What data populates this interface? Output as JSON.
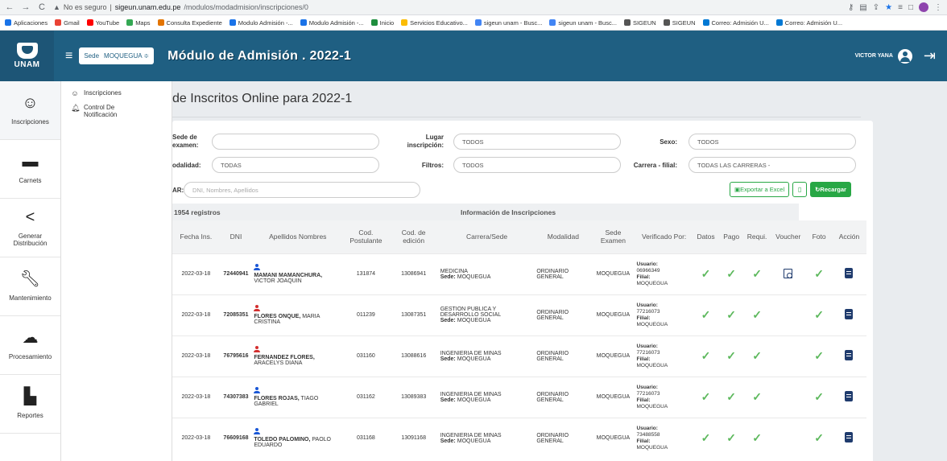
{
  "browser": {
    "warning": "No es seguro",
    "url_host": "sigeun.unam.edu.pe",
    "url_path": "/modulos/modadmision/inscripciones/0"
  },
  "bookmarks": [
    "Aplicaciones",
    "Gmail",
    "YouTube",
    "Maps",
    "Consulta Expediente",
    "Modulo Admisión -...",
    "Modulo Admisión -...",
    "Inicio",
    "Servicios Educativo...",
    "sigeun unam - Busc...",
    "sigeun unam - Busc...",
    "SIGEUN",
    "SIGEUN",
    "Correo: Admisión U...",
    "Correo: Admisión U..."
  ],
  "header": {
    "logo_text": "UNAM",
    "sede_label": "Sede",
    "sede_value": "MOQUEGUA ≑",
    "title": "Módulo de Admisión . 2022-1",
    "user": "VICTOR YANA"
  },
  "sidebar": [
    {
      "label": "Inscripciones",
      "icon": "smile-icon"
    },
    {
      "label": "Carnets",
      "icon": "card-icon"
    },
    {
      "label": "Generar Distribución",
      "icon": "share-icon"
    },
    {
      "label": "Mantenimiento",
      "icon": "wrench-icon"
    },
    {
      "label": "Procesamiento",
      "icon": "cloud-icon"
    },
    {
      "label": "Reportes",
      "icon": "file-icon"
    }
  ],
  "submenu": [
    {
      "label": "Inscripciones"
    },
    {
      "label": "Control De Notificación"
    }
  ],
  "page": {
    "title": "de Inscritos Online para 2022-1"
  },
  "filters": {
    "sede_examen_label": "Sede de examen:",
    "sede_examen_value": "",
    "lugar_label": "Lugar inscripción:",
    "lugar_value": "TODOS",
    "sexo_label": "Sexo:",
    "sexo_value": "TODOS",
    "modalidad_label": "odalidad:",
    "modalidad_value": "TODAS",
    "filtros_label": "Filtros:",
    "filtros_value": "TODOS",
    "carrera_label": "Carrera - filial:",
    "carrera_value": "TODAS LAS CARRERAS -",
    "search_label": "AR:",
    "search_placeholder": "DNI, Nombres, Apellidos"
  },
  "buttons": {
    "excel": "Exportar a Excel",
    "reload": "Recargar"
  },
  "info": {
    "registros": "1954 registros",
    "heading": "Información de Inscripciones"
  },
  "columns": [
    "Fecha Ins.",
    "DNI",
    "Apellidos Nombres",
    "Cod. Postulante",
    "Cod. de edición",
    "Carrera/Sede",
    "Modalidad",
    "Sede Examen",
    "Verificado Por:",
    "Datos",
    "Pago",
    "Requi.",
    "Voucher",
    "Foto",
    "Acción"
  ],
  "rows": [
    {
      "fecha": "2022-03-18",
      "dni": "72440941",
      "apellidos": "MAMANI MAMANCHURA,",
      "nombres": " VICTOR JOAQUIN",
      "sex": "m",
      "cod_post": "131874",
      "cod_ed": "13086941",
      "carrera": "MEDICINA",
      "sede": "MOQUEGUA",
      "modalidad": "ORDINARIO GENERAL",
      "sede_ex": "MOQUEGUA",
      "usuario": "06966349",
      "filial": "MOQUEGUA",
      "voucher": true
    },
    {
      "fecha": "2022-03-18",
      "dni": "72085351",
      "apellidos": "FLORES ONQUE,",
      "nombres": " MARIA CRISTINA",
      "sex": "f",
      "cod_post": "011239",
      "cod_ed": "13087351",
      "carrera": "GESTION PUBLICA Y DESARROLLO SOCIAL",
      "sede": "MOQUEGUA",
      "modalidad": "ORDINARIO GENERAL",
      "sede_ex": "MOQUEGUA",
      "usuario": "77216073",
      "filial": "MOQUEGUA",
      "voucher": false
    },
    {
      "fecha": "2022-03-18",
      "dni": "76795616",
      "apellidos": "FERNANDEZ FLORES,",
      "nombres": " ARACELYS DIANA",
      "sex": "f",
      "cod_post": "031160",
      "cod_ed": "13088616",
      "carrera": "INGENIERIA DE MINAS",
      "sede": "MOQUEGUA",
      "modalidad": "ORDINARIO GENERAL",
      "sede_ex": "MOQUEGUA",
      "usuario": "77216073",
      "filial": "MOQUEGUA",
      "voucher": false
    },
    {
      "fecha": "2022-03-18",
      "dni": "74307383",
      "apellidos": "FLORES ROJAS,",
      "nombres": " TIAGO GABRIEL",
      "sex": "m",
      "cod_post": "031162",
      "cod_ed": "13089383",
      "carrera": "INGENIERIA DE MINAS",
      "sede": "MOQUEGUA",
      "modalidad": "ORDINARIO GENERAL",
      "sede_ex": "MOQUEGUA",
      "usuario": "77216073",
      "filial": "MOQUEGUA",
      "voucher": false
    },
    {
      "fecha": "2022-03-18",
      "dni": "76609168",
      "apellidos": "TOLEDO PALOMINO,",
      "nombres": " PAOLO EDUARDO",
      "sex": "m",
      "cod_post": "031168",
      "cod_ed": "13091168",
      "carrera": "INGENIERIA DE MINAS",
      "sede": "MOQUEGUA",
      "modalidad": "ORDINARIO GENERAL",
      "sede_ex": "MOQUEGUA",
      "usuario": "73488558",
      "filial": "MOQUEGUA",
      "voucher": false
    }
  ],
  "labels": {
    "sede": "Sede:",
    "usuario": "Usuario:",
    "filial": "Filial:"
  }
}
